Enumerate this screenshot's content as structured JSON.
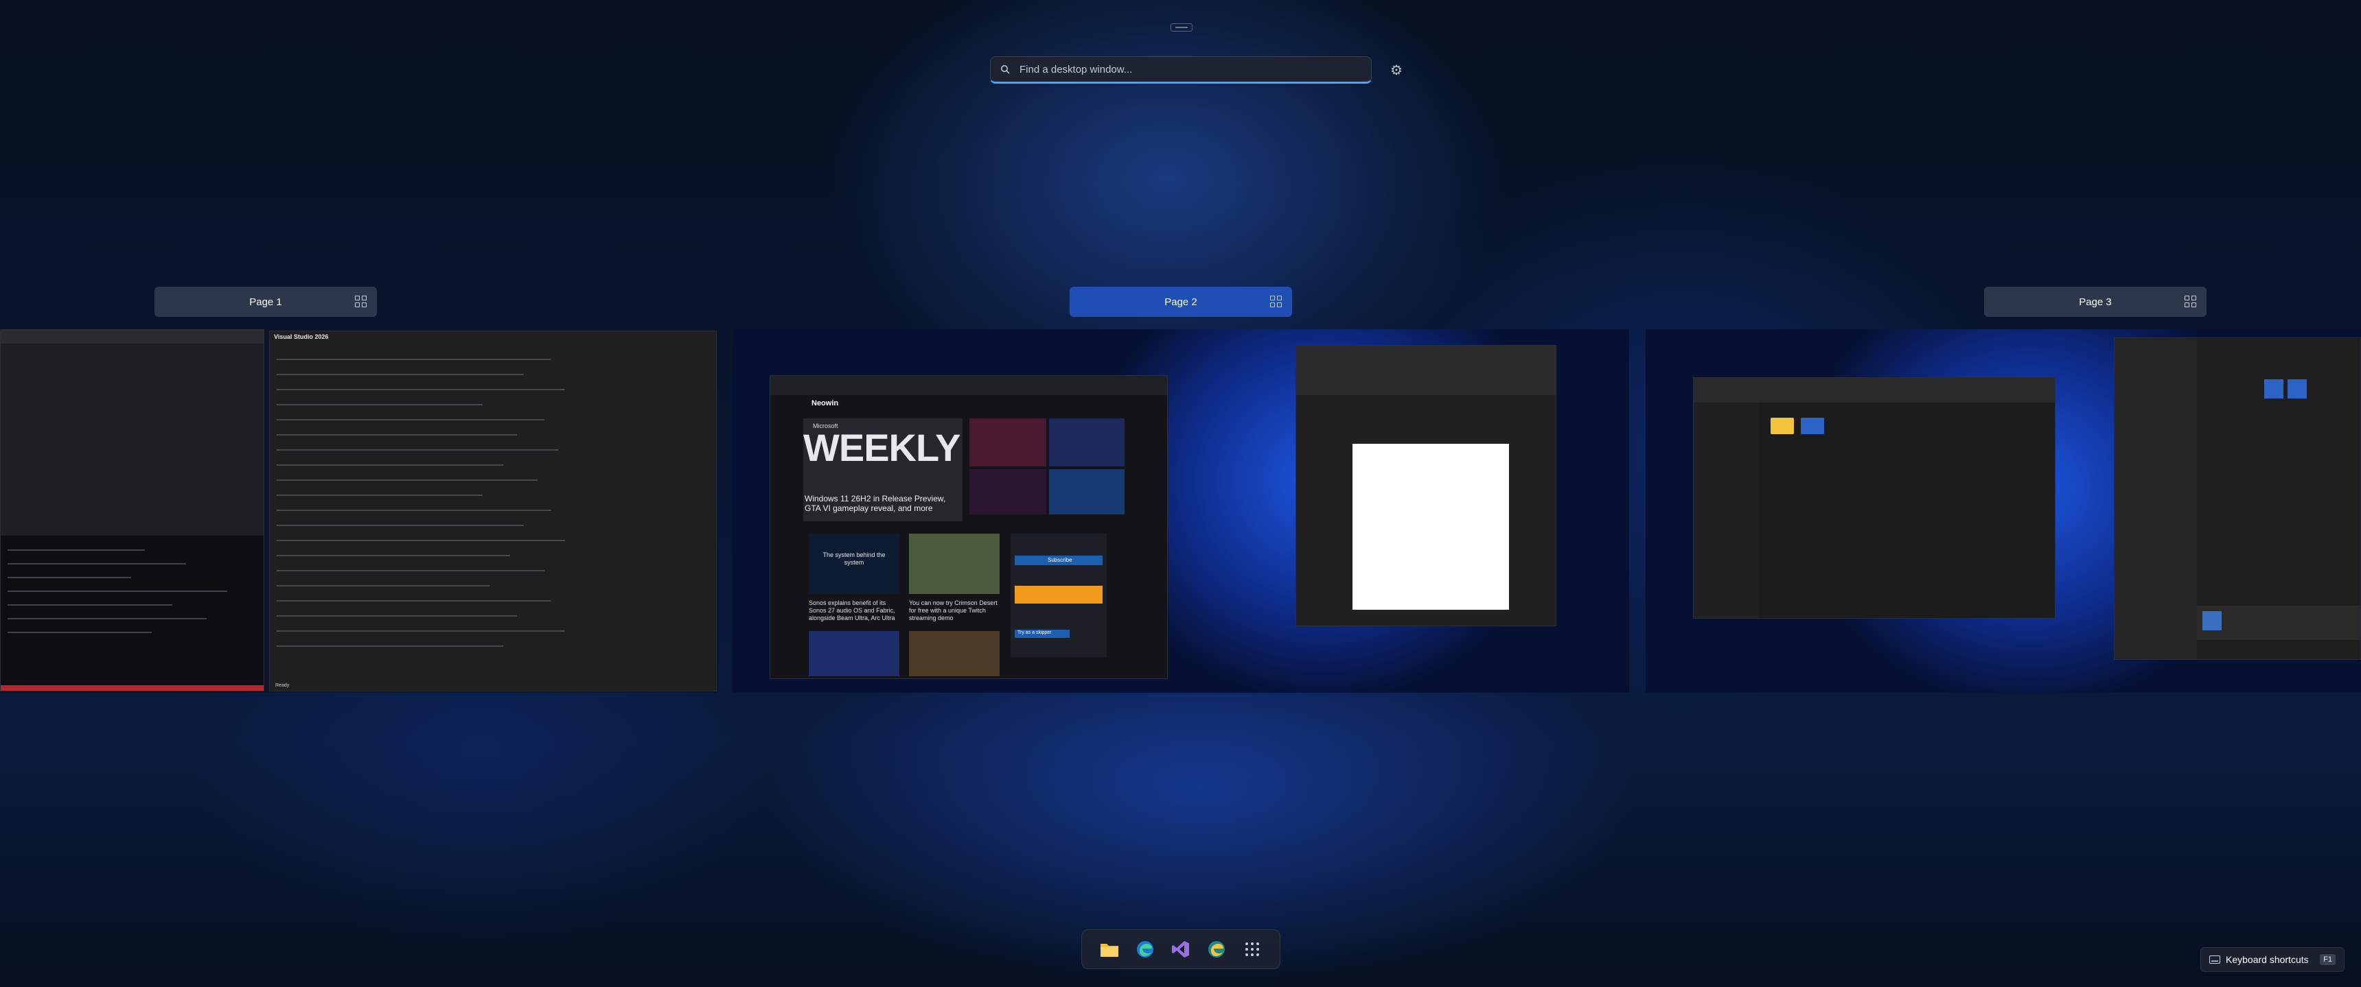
{
  "search": {
    "placeholder": "Find a desktop window..."
  },
  "pages": [
    {
      "label": "Page 1",
      "active": false
    },
    {
      "label": "Page 2",
      "active": true
    },
    {
      "label": "Page 3",
      "active": false
    }
  ],
  "page1": {
    "vs_window_title": "Visual Studio 2026",
    "vs_status": "Ready"
  },
  "page2": {
    "browser": {
      "logo": "Neowin",
      "banner_small": "Microsoft",
      "banner_big": "WEEKLY",
      "headline": "Windows 11 26H2 in Release Preview, GTA VI gameplay reveal, and more",
      "card1_title": "The system behind the system",
      "card1_caption": "Sonos explains benefit of its Sonos 27 audio OS and Fabric, alongside Beam Ultra, Arc Ultra",
      "card2_caption": "You can now try Crimson Desert for free with a unique Twitch streaming demo",
      "subscribe_label": "Subscribe",
      "try_label": "Try as a skipper"
    }
  },
  "dock": [
    {
      "name": "file-explorer-icon",
      "color": "#f3c33e"
    },
    {
      "name": "edge-icon",
      "color": "#2aa6e0"
    },
    {
      "name": "visual-studio-icon",
      "color": "#9a6ee5"
    },
    {
      "name": "edge-canary-icon",
      "color": "#3bb36a"
    },
    {
      "name": "app-grid-icon",
      "color": "#c8d0e0"
    }
  ],
  "keyboard": {
    "label": "Keyboard shortcuts",
    "key": "F1"
  },
  "colors": {
    "accent": "#4aa3ff",
    "active_page": "#1f4fb5"
  }
}
